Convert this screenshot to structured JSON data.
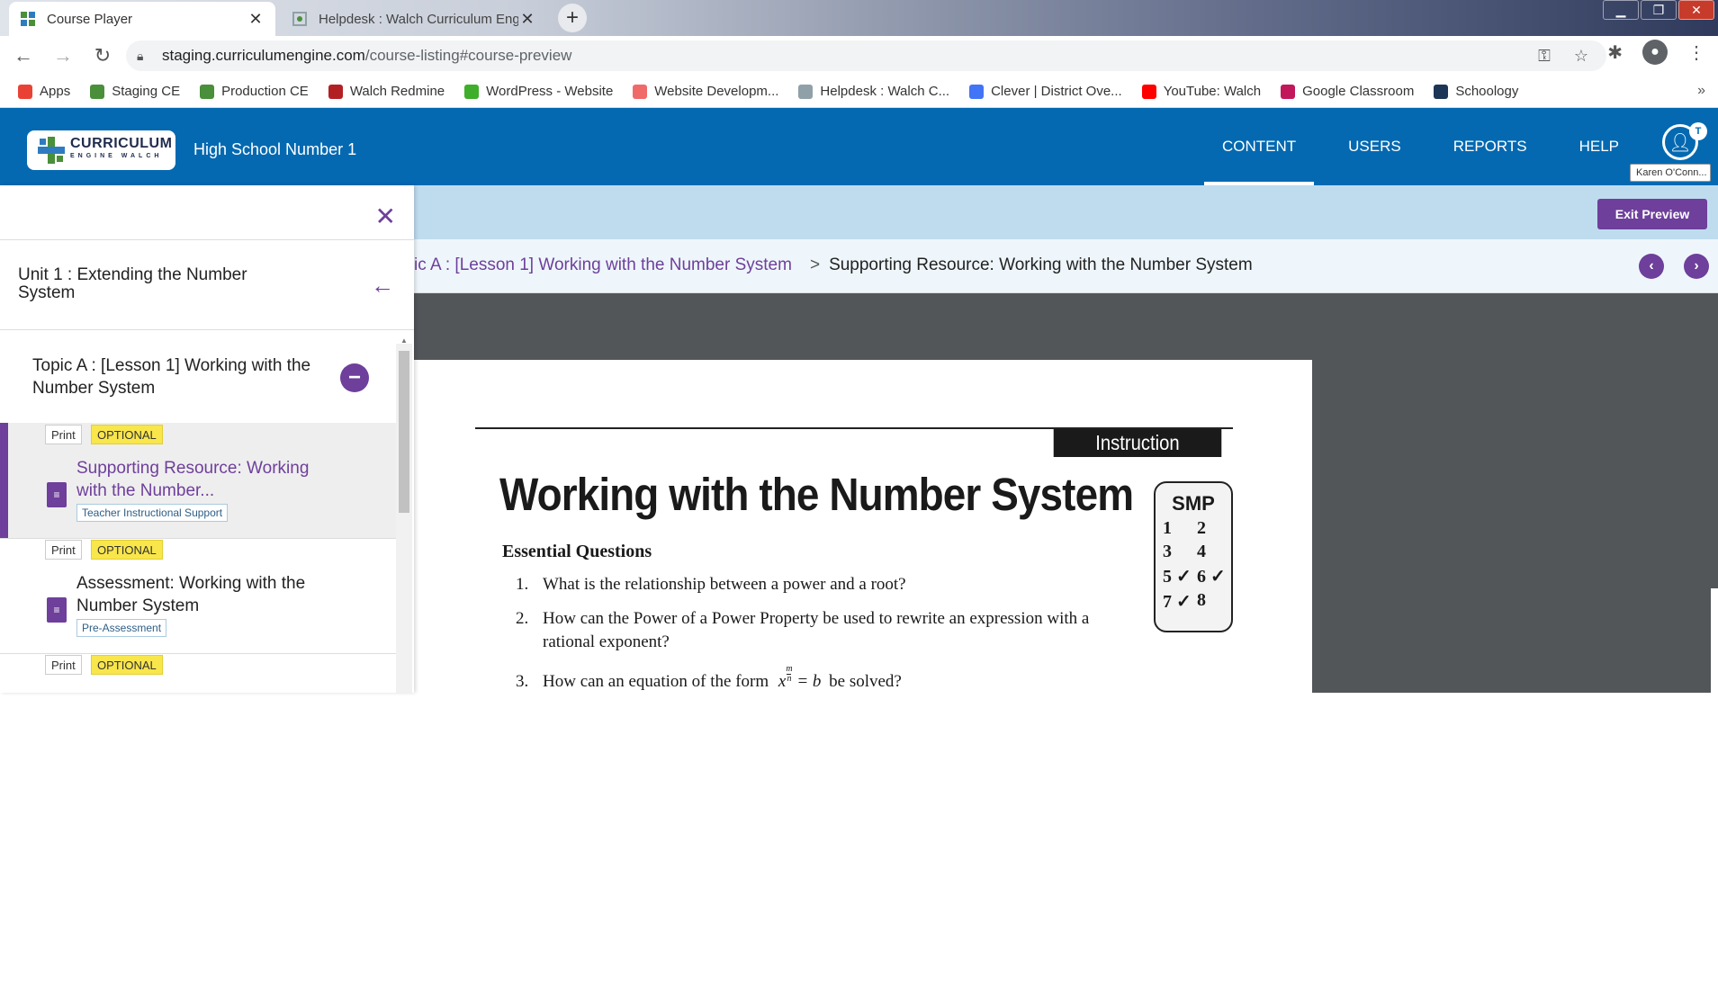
{
  "browser": {
    "tabs": [
      {
        "title": "Course Player",
        "active": true
      },
      {
        "title": "Helpdesk : Walch Curriculum Eng",
        "active": false
      }
    ],
    "new_tab": "+",
    "close_glyph": "✕",
    "url_host": "staging.curriculumengine.com",
    "url_path": "/course-listing#course-preview",
    "bookmarks": [
      {
        "label": "Apps",
        "icon": "apps-grid-icon",
        "color": "#e94235"
      },
      {
        "label": "Staging CE",
        "icon": "curriculum-engine-icon",
        "color": "#4a8f3a"
      },
      {
        "label": "Production CE",
        "icon": "curriculum-engine-icon",
        "color": "#4a8f3a"
      },
      {
        "label": "Walch Redmine",
        "icon": "redmine-icon",
        "color": "#b32024"
      },
      {
        "label": "WordPress - Website",
        "icon": "wordpress-icon",
        "color": "#3fae2a"
      },
      {
        "label": "Website Developm...",
        "icon": "asana-icon",
        "color": "#f06a6a"
      },
      {
        "label": "Helpdesk : Walch C...",
        "icon": "helpdesk-icon",
        "color": "#8fa0a8"
      },
      {
        "label": "Clever | District Ove...",
        "icon": "clever-icon",
        "color": "#4274f6"
      },
      {
        "label": "YouTube: Walch",
        "icon": "youtube-icon",
        "color": "#ff0000"
      },
      {
        "label": "Google Classroom",
        "icon": "classroom-icon",
        "color": "#c2185b"
      },
      {
        "label": "Schoology",
        "icon": "schoology-icon",
        "color": "#1d3557"
      }
    ],
    "bookmarks_more": "»"
  },
  "app": {
    "logo_text": "CURRICULUM",
    "logo_sub": "ENGINE WALCH",
    "school": "High School Number 1",
    "nav": [
      "CONTENT",
      "USERS",
      "REPORTS",
      "HELP"
    ],
    "active_nav": "CONTENT",
    "user_badge": "T",
    "user_name": "Karen O'Conn...",
    "brand_color": "#0469b1",
    "accent_color": "#6e3f9b"
  },
  "preview": {
    "exit_label": "Exit Preview"
  },
  "breadcrumb": {
    "link": "ic A : [Lesson 1] Working with the Number System",
    "separator": ">",
    "current": "Supporting Resource: Working with the Number System"
  },
  "sidebar": {
    "close": "✕",
    "unit": "Unit 1 : Extending the Number System",
    "back": "←",
    "topic": "Topic A : [Lesson 1] Working with the Number System",
    "collapse": "−",
    "resources": [
      {
        "print": "Print",
        "optional": "OPTIONAL",
        "title": "Supporting Resource: Working with the Number...",
        "sub": "Teacher Instructional Support",
        "selected": true
      },
      {
        "print": "Print",
        "optional": "OPTIONAL",
        "title": "Assessment: Working with the Number System",
        "sub": "Pre-Assessment",
        "selected": false
      },
      {
        "print": "Print",
        "optional": "OPTIONAL",
        "title": "",
        "sub": "",
        "selected": false
      }
    ]
  },
  "document": {
    "banner": "Instruction",
    "title": "Working with the Number System",
    "eq_heading": "Essential Questions",
    "questions": [
      {
        "n": "1.",
        "text": "What is the relationship between a power and a root?"
      },
      {
        "n": "2.",
        "text": "How can the Power of a Power Property be used to rewrite an expression with a"
      },
      {
        "n": "",
        "text": "rational exponent?"
      },
      {
        "n": "3.",
        "text": "How can an equation of the form"
      },
      {
        "n": "",
        "text": "be solved?"
      }
    ],
    "formula_base": "x",
    "formula_num": "m",
    "formula_den": "n",
    "formula_rhs": "= b",
    "smp": {
      "heading": "SMP",
      "rows": [
        [
          "1",
          "2"
        ],
        [
          "3",
          "4"
        ],
        [
          "5 ✓",
          "6 ✓"
        ],
        [
          "7 ✓",
          "8"
        ]
      ]
    }
  }
}
